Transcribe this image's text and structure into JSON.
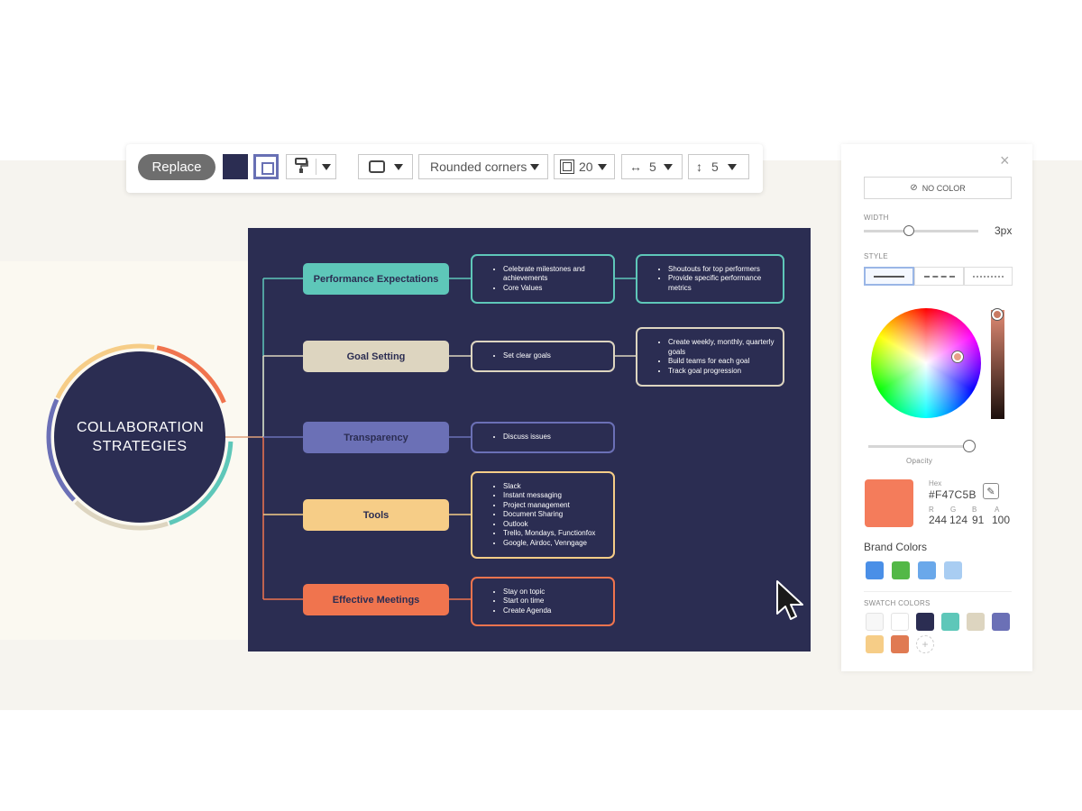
{
  "toolbar": {
    "replace_label": "Replace",
    "shape_style_label": "Rounded corners",
    "corner_value": "20",
    "h_spacing_value": "5",
    "v_spacing_value": "5"
  },
  "diagram": {
    "hub_title": "COLLABORATION STRATEGIES",
    "branches": [
      {
        "label": "Performance Expectations",
        "color": "#5ec7b9",
        "details": [
          "Celebrate milestones and achievements",
          "Core Values"
        ],
        "sub_details": [
          "Shoutouts for top performers",
          "Provide specific performance metrics"
        ]
      },
      {
        "label": "Goal Setting",
        "color": "#ddd5c0",
        "details": [
          "Set clear goals"
        ],
        "sub_details": [
          "Create weekly, monthly, quarterly goals",
          "Build teams for each goal",
          "Track goal progression"
        ]
      },
      {
        "label": "Transparency",
        "color": "#6b70b6",
        "details": [
          "Discuss issues"
        ]
      },
      {
        "label": "Tools",
        "color": "#f6cd87",
        "details": [
          "Slack",
          "Instant messaging",
          "Project management",
          "Document Sharing",
          "Outlook",
          "Trello, Mondays, Functionfox",
          "Google, Airdoc, Venngage"
        ]
      },
      {
        "label": "Effective Meetings",
        "color": "#f0744e",
        "details": [
          "Stay on topic",
          "Start on time",
          "Create Agenda"
        ]
      }
    ]
  },
  "panel": {
    "no_color_label": "NO COLOR",
    "width_label": "WIDTH",
    "width_value": "3px",
    "width_fraction": 0.39,
    "style_label": "STYLE",
    "opacity_label": "Opacity",
    "opacity_fraction": 1.0,
    "hex_label": "Hex",
    "hex_value": "#F47C5B",
    "rgba_labels": [
      "R",
      "G",
      "B",
      "A"
    ],
    "rgba_values": [
      "244",
      "124",
      "91",
      "100"
    ],
    "brand_colors_title": "Brand Colors",
    "brand_colors": [
      "#4a8fe7",
      "#53b847",
      "#6aa8ea",
      "#a9cdf2"
    ],
    "swatch_title": "SWATCH COLORS",
    "swatch_colors": [
      "#f7f7f7",
      "#ffffff",
      "#2b2d52",
      "#5ec7b9",
      "#ddd5c0",
      "#6b70b6",
      "#f6cd87",
      "#e07a52"
    ]
  }
}
